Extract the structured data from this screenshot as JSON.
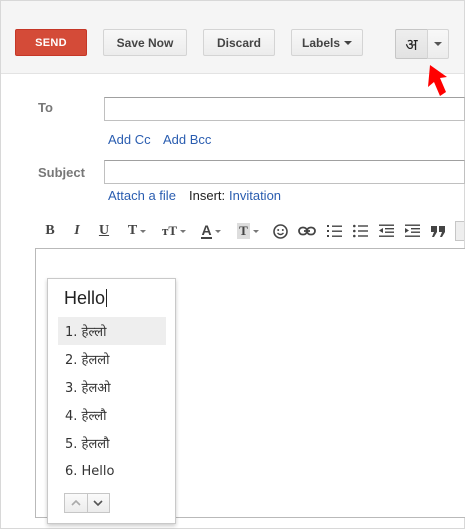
{
  "toolbar": {
    "send_label": "SEND",
    "save_label": "Save Now",
    "discard_label": "Discard",
    "labels_label": "Labels",
    "input_tool_glyph": "अ"
  },
  "form": {
    "to_label": "To",
    "add_cc": "Add Cc",
    "add_bcc": "Add Bcc",
    "subject_label": "Subject",
    "attach": "Attach a file",
    "insert_label": "Insert:",
    "insert_invitation": "Invitation"
  },
  "format_toolbar": {
    "icons": [
      "bold-icon",
      "italic-icon",
      "underline-icon",
      "font-icon",
      "font-size-icon",
      "text-color-icon",
      "highlight-icon",
      "emoji-icon",
      "link-icon",
      "numbered-list-icon",
      "bulleted-list-icon",
      "indent-less-icon",
      "indent-more-icon",
      "quote-icon"
    ],
    "bold": "B",
    "italic": "I",
    "underline": "U",
    "font": "T",
    "font_size": "тT",
    "text_color": "A",
    "highlight": "T"
  },
  "ime_popup": {
    "typed": "Hello",
    "selected_index": 0,
    "candidates": [
      "1. हेल्लो",
      "2. हेललो",
      "3. हेलओ",
      "4. हेल्लौ",
      "5. हेललौ",
      "6. Hello"
    ]
  },
  "colors": {
    "send_button": "#d44b38",
    "link": "#2a5db0",
    "annotation_arrow": "#ff0000"
  }
}
